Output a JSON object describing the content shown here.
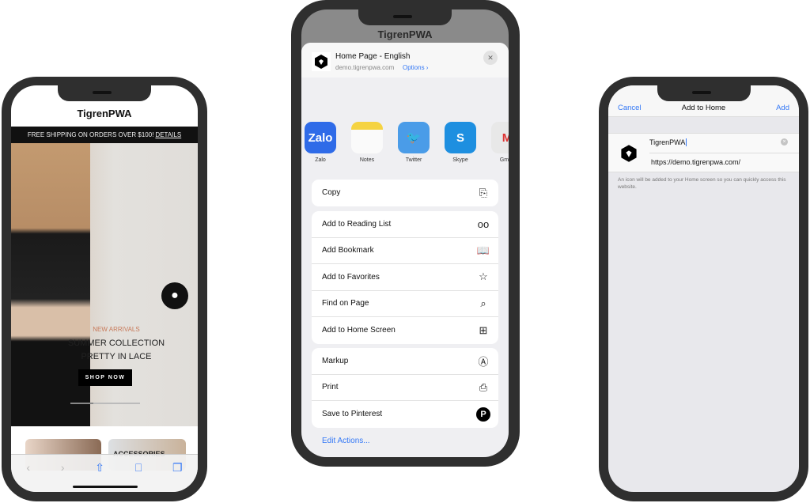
{
  "phone1": {
    "brand": "TigrenPWA",
    "promo": "FREE SHIPPING ON ORDERS OVER $100!",
    "promo_link": "DETAILS",
    "hero": {
      "eyebrow": "NEW ARRIVALS",
      "title1": "SUMMER COLLECTION",
      "title2": "PRETTY IN LACE",
      "cta": "SHOP NOW",
      "slide_progress": 0.33
    },
    "category_label": "ACCESSORIES",
    "toolbar": {
      "back": "‹",
      "forward": "›",
      "share": "⇧",
      "bookmarks": "📖",
      "tabs": "❐"
    }
  },
  "phone2": {
    "brand": "TigrenPWA",
    "sheet": {
      "title": "Home Page - English",
      "url": "demo.tigrenpwa.com",
      "options": "Options ›",
      "close": "✕"
    },
    "apps": [
      {
        "label": "Zalo",
        "glyph": "Zalo",
        "color": "#2f6be8"
      },
      {
        "label": "Notes",
        "glyph": "",
        "color": "#f5d342"
      },
      {
        "label": "Twitter",
        "glyph": "🐦",
        "color": "#4a9ce8"
      },
      {
        "label": "Skype",
        "glyph": "S",
        "color": "#1e8fe0"
      },
      {
        "label": "Gmail",
        "glyph": "M",
        "color": "#e8e8e8"
      }
    ],
    "group1": [
      {
        "label": "Copy",
        "icon": "copy-icon",
        "glyph": "⎘"
      }
    ],
    "group2": [
      {
        "label": "Add to Reading List",
        "icon": "glasses-icon",
        "glyph": "oo"
      },
      {
        "label": "Add Bookmark",
        "icon": "book-icon",
        "glyph": "📖"
      },
      {
        "label": "Add to Favorites",
        "icon": "star-icon",
        "glyph": "☆"
      },
      {
        "label": "Find on Page",
        "icon": "search-icon",
        "glyph": "⌕"
      },
      {
        "label": "Add to Home Screen",
        "icon": "plus-square-icon",
        "glyph": "⊞"
      }
    ],
    "group3": [
      {
        "label": "Markup",
        "icon": "markup-icon",
        "glyph": "Ⓐ"
      },
      {
        "label": "Print",
        "icon": "printer-icon",
        "glyph": "⎙"
      },
      {
        "label": "Save to Pinterest",
        "icon": "pinterest-icon",
        "glyph": "P"
      }
    ],
    "edit_actions": "Edit Actions..."
  },
  "phone3": {
    "cancel": "Cancel",
    "title": "Add to Home",
    "add": "Add",
    "name_value": "TigrenPWA",
    "url": "https://demo.tigrenpwa.com/",
    "hint": "An icon will be added to your Home screen so you can quickly access this website."
  },
  "colors": {
    "ios_blue": "#3478f6",
    "frame": "#2f2f2f",
    "accent": "#c87a5a"
  }
}
